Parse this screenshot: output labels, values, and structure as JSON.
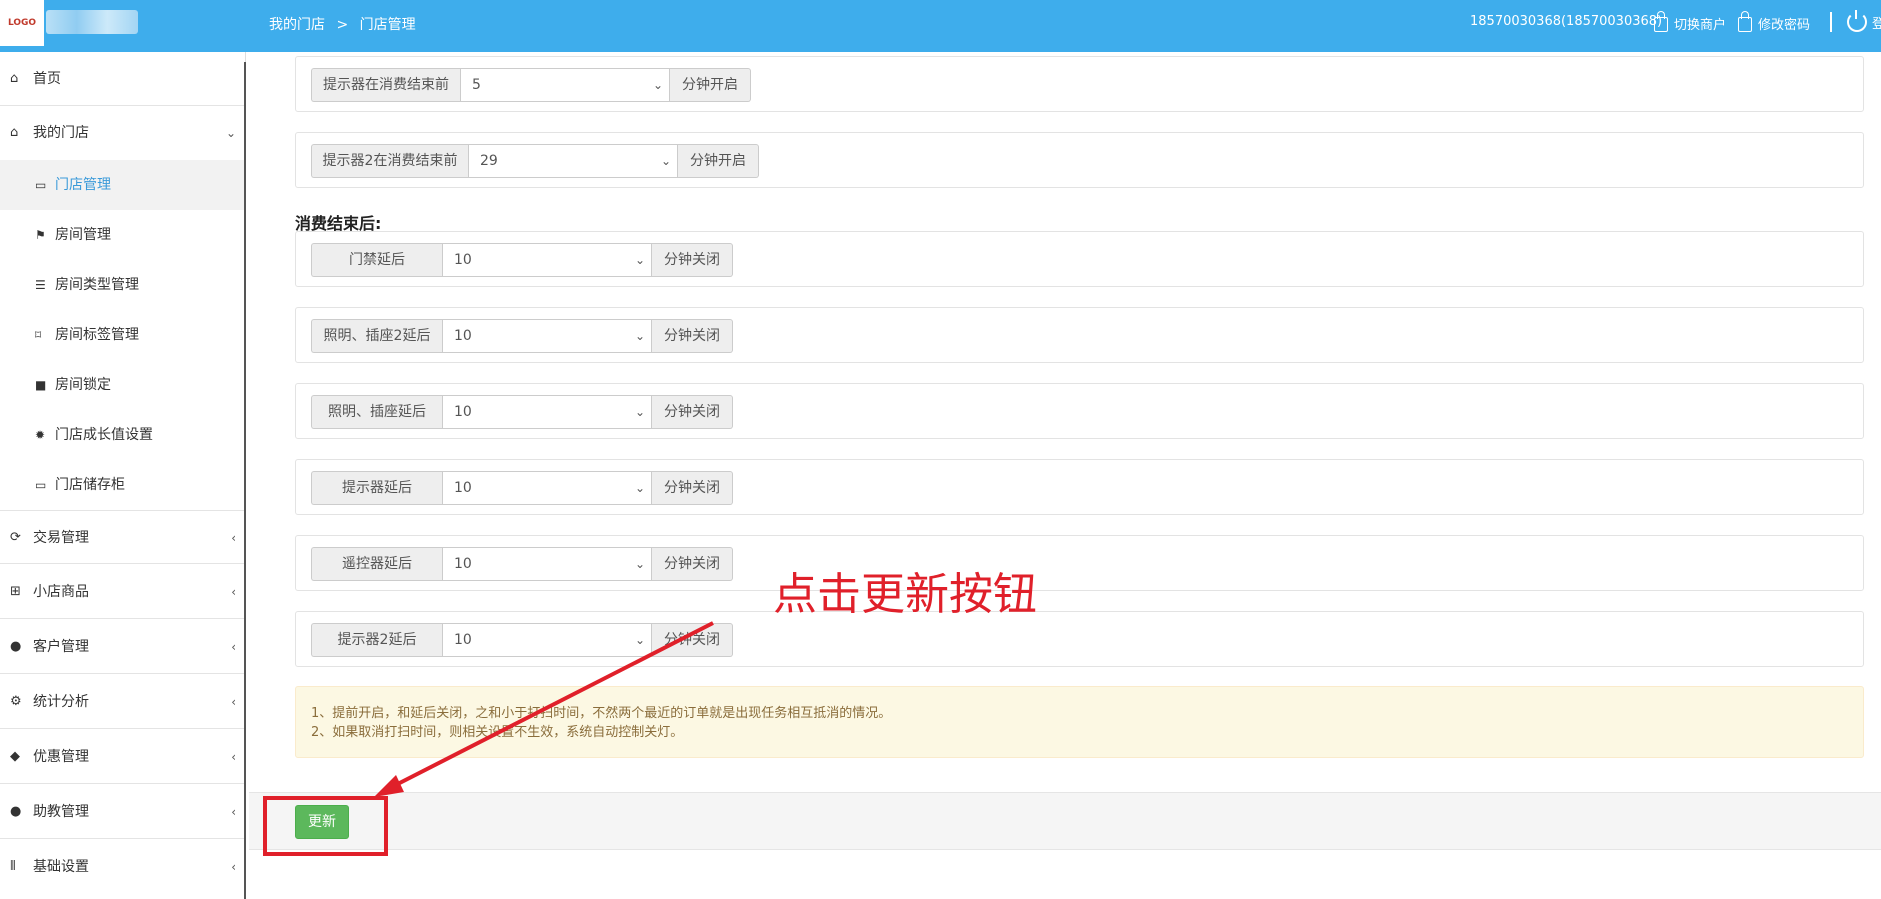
{
  "header": {
    "breadcrumb": [
      "我的门店",
      ">",
      "门店管理"
    ],
    "user": "18570030368(18570030368)",
    "switch_merchant": "切换商户",
    "change_password": "修改密码",
    "logout_partial": "登",
    "accent": "#3eadec"
  },
  "sidebar": {
    "items": [
      {
        "label": "首页",
        "icon": "home-icon"
      },
      {
        "label": "我的门店",
        "icon": "home-icon",
        "expanded": true
      },
      {
        "label": "门店管理",
        "icon": "inbox-icon",
        "active": true
      },
      {
        "label": "房间管理",
        "icon": "flag-icon"
      },
      {
        "label": "房间类型管理",
        "icon": "list-icon"
      },
      {
        "label": "房间标签管理",
        "icon": "bookmark-icon"
      },
      {
        "label": "房间锁定",
        "icon": "lock-icon"
      },
      {
        "label": "门店成长值设置",
        "icon": "certificate-icon"
      },
      {
        "label": "门店储存柜",
        "icon": "inbox-icon"
      },
      {
        "label": "交易管理",
        "icon": "refresh-icon"
      },
      {
        "label": "小店商品",
        "icon": "gift-icon"
      },
      {
        "label": "客户管理",
        "icon": "user-icon"
      },
      {
        "label": "统计分析",
        "icon": "gear-icon"
      },
      {
        "label": "优惠管理",
        "icon": "tags-icon"
      },
      {
        "label": "助教管理",
        "icon": "user-icon"
      },
      {
        "label": "基础设置",
        "icon": "barcode-icon"
      }
    ]
  },
  "form": {
    "before_rows": [
      {
        "label": "提示器在消费结束前",
        "value": "5",
        "addon": "分钟开启"
      },
      {
        "label": "提示器2在消费结束前",
        "value": "29",
        "addon": "分钟开启"
      }
    ],
    "after_heading": "消费结束后:",
    "after_rows": [
      {
        "label": "门禁延后",
        "value": "10",
        "addon": "分钟关闭"
      },
      {
        "label": "照明、插座2延后",
        "value": "10",
        "addon": "分钟关闭"
      },
      {
        "label": "照明、插座延后",
        "value": "10",
        "addon": "分钟关闭"
      },
      {
        "label": "提示器延后",
        "value": "10",
        "addon": "分钟关闭"
      },
      {
        "label": "遥控器延后",
        "value": "10",
        "addon": "分钟关闭"
      },
      {
        "label": "提示器2延后",
        "value": "10",
        "addon": "分钟关闭"
      }
    ],
    "notice_lines": [
      "1、提前开启，和延后关闭，之和小于打扫时间，不然两个最近的订单就是出现任务相互抵消的情况。",
      "2、如果取消打扫时间，则相关设置不生效，系统自动控制关灯。"
    ],
    "update_label": "更新",
    "update_color": "#5cb85c"
  },
  "annotation": {
    "text": "点击更新按钮",
    "color": "#e0202a"
  }
}
